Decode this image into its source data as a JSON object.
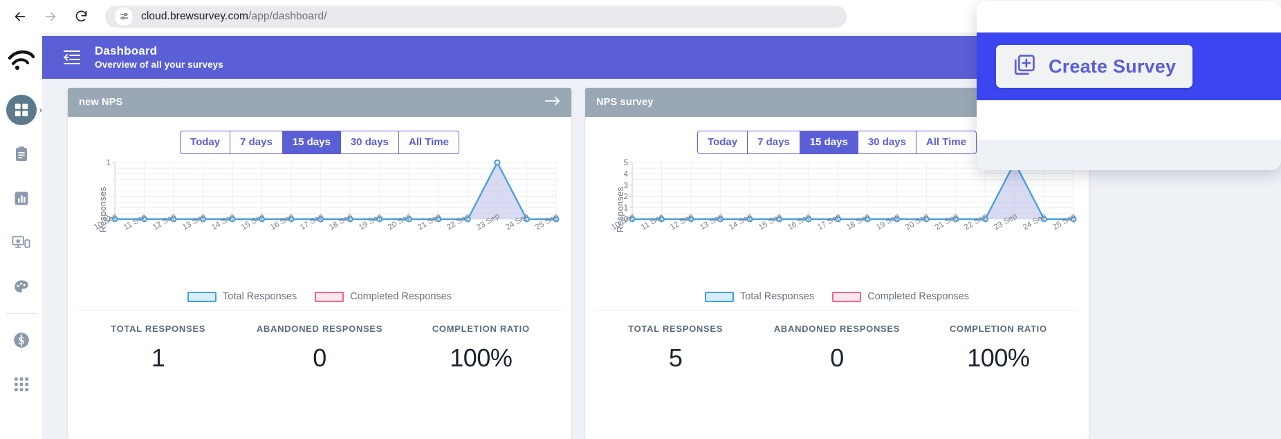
{
  "browser": {
    "back_icon": "back-arrow-icon",
    "forward_icon": "forward-arrow-icon",
    "reload_icon": "reload-icon",
    "site_info_icon": "site-settings-icon",
    "url_host": "cloud.brewsurvey.com",
    "url_path": "/app/dashboard/"
  },
  "rail": {
    "logo_icon": "wifi-logo-icon",
    "items": [
      {
        "icon": "dashboard-grid-icon",
        "active": true
      },
      {
        "icon": "clipboard-icon",
        "active": false
      },
      {
        "icon": "bar-chart-icon",
        "active": false
      },
      {
        "icon": "device-star-icon",
        "active": false
      },
      {
        "icon": "palette-icon",
        "active": false
      },
      {
        "icon": "dollar-icon",
        "active": false
      },
      {
        "icon": "apps-grid-icon",
        "active": false
      }
    ],
    "expand_chevron": "›"
  },
  "topbar": {
    "menu_icon": "collapse-menu-icon",
    "title": "Dashboard",
    "subtitle": "Overview of all your surveys",
    "accent_color": "#5a5fd6"
  },
  "overlay": {
    "create_button_label": "Create Survey",
    "create_button_icon": "copy-plus-icon",
    "band_color": "#3b46f0"
  },
  "ranges": [
    "Today",
    "7 days",
    "15 days",
    "30 days",
    "All Time"
  ],
  "active_range": "15 days",
  "legend": [
    {
      "label": "Total Responses",
      "color": "#3aa0e8",
      "fill": "#d9ecfb"
    },
    {
      "label": "Completed Responses",
      "color": "#f8637f",
      "fill": "#fde7ee"
    }
  ],
  "stat_labels": {
    "total": "TOTAL RESPONSES",
    "abandoned": "ABANDONED RESPONSES",
    "ratio": "COMPLETION RATIO"
  },
  "cards": [
    {
      "title": "new NPS",
      "arrow_icon": "arrow-right-icon",
      "has_arrow": true,
      "stats": {
        "total": "1",
        "abandoned": "0",
        "ratio": "100%"
      }
    },
    {
      "title": "NPS survey",
      "arrow_icon": "arrow-right-icon",
      "has_arrow": false,
      "stats": {
        "total": "5",
        "abandoned": "0",
        "ratio": "100%"
      }
    }
  ],
  "chart_data": [
    {
      "type": "line",
      "title": "new NPS",
      "xlabel": "",
      "ylabel": "Responses",
      "ylim": [
        0,
        1
      ],
      "yticks": [
        0,
        1
      ],
      "grid": true,
      "legend_position": "bottom",
      "x": [
        "10 Sep",
        "11 Sep",
        "12 Sep",
        "13 Sep",
        "14 Sep",
        "15 Sep",
        "16 Sep",
        "17 Sep",
        "18 Sep",
        "19 Sep",
        "20 Sep",
        "21 Sep",
        "22 Sep",
        "23 Sep",
        "24 Sep",
        "25 Sep"
      ],
      "series": [
        {
          "name": "Total Responses",
          "values": [
            0,
            0,
            0,
            0,
            0,
            0,
            0,
            0,
            0,
            0,
            0,
            0,
            0,
            1,
            0,
            0
          ]
        },
        {
          "name": "Completed Responses",
          "values": [
            0,
            0,
            0,
            0,
            0,
            0,
            0,
            0,
            0,
            0,
            0,
            0,
            0,
            0,
            0,
            0
          ]
        }
      ]
    },
    {
      "type": "line",
      "title": "NPS survey",
      "xlabel": "",
      "ylabel": "Responses",
      "ylim": [
        0,
        5
      ],
      "yticks": [
        0,
        1,
        2,
        3,
        4,
        5
      ],
      "grid": true,
      "legend_position": "bottom",
      "x": [
        "10 Sep",
        "11 Sep",
        "12 Sep",
        "13 Sep",
        "14 Sep",
        "15 Sep",
        "16 Sep",
        "17 Sep",
        "18 Sep",
        "19 Sep",
        "20 Sep",
        "21 Sep",
        "22 Sep",
        "23 Sep",
        "24 Sep",
        "25 Sep"
      ],
      "series": [
        {
          "name": "Total Responses",
          "values": [
            0,
            0,
            0,
            0,
            0,
            0,
            0,
            0,
            0,
            0,
            0,
            0,
            0,
            5,
            0,
            0
          ]
        },
        {
          "name": "Completed Responses",
          "values": [
            0,
            0,
            0,
            0,
            0,
            0,
            0,
            0,
            0,
            0,
            0,
            0,
            0,
            0,
            0,
            0
          ]
        }
      ]
    }
  ]
}
